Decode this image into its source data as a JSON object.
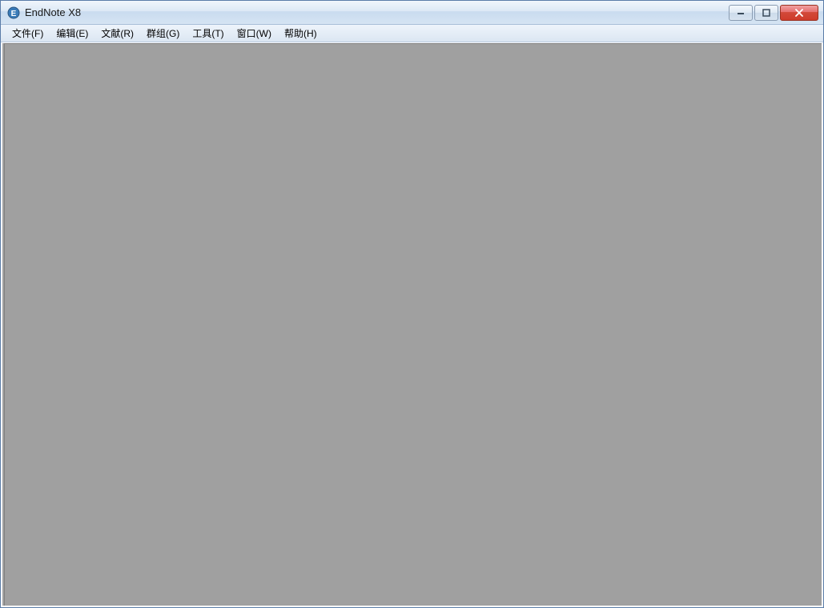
{
  "window": {
    "title": "EndNote X8"
  },
  "menubar": {
    "items": [
      {
        "label": "文件(F)"
      },
      {
        "label": "编辑(E)"
      },
      {
        "label": "文献(R)"
      },
      {
        "label": "群组(G)"
      },
      {
        "label": "工具(T)"
      },
      {
        "label": "窗口(W)"
      },
      {
        "label": "帮助(H)"
      }
    ]
  }
}
